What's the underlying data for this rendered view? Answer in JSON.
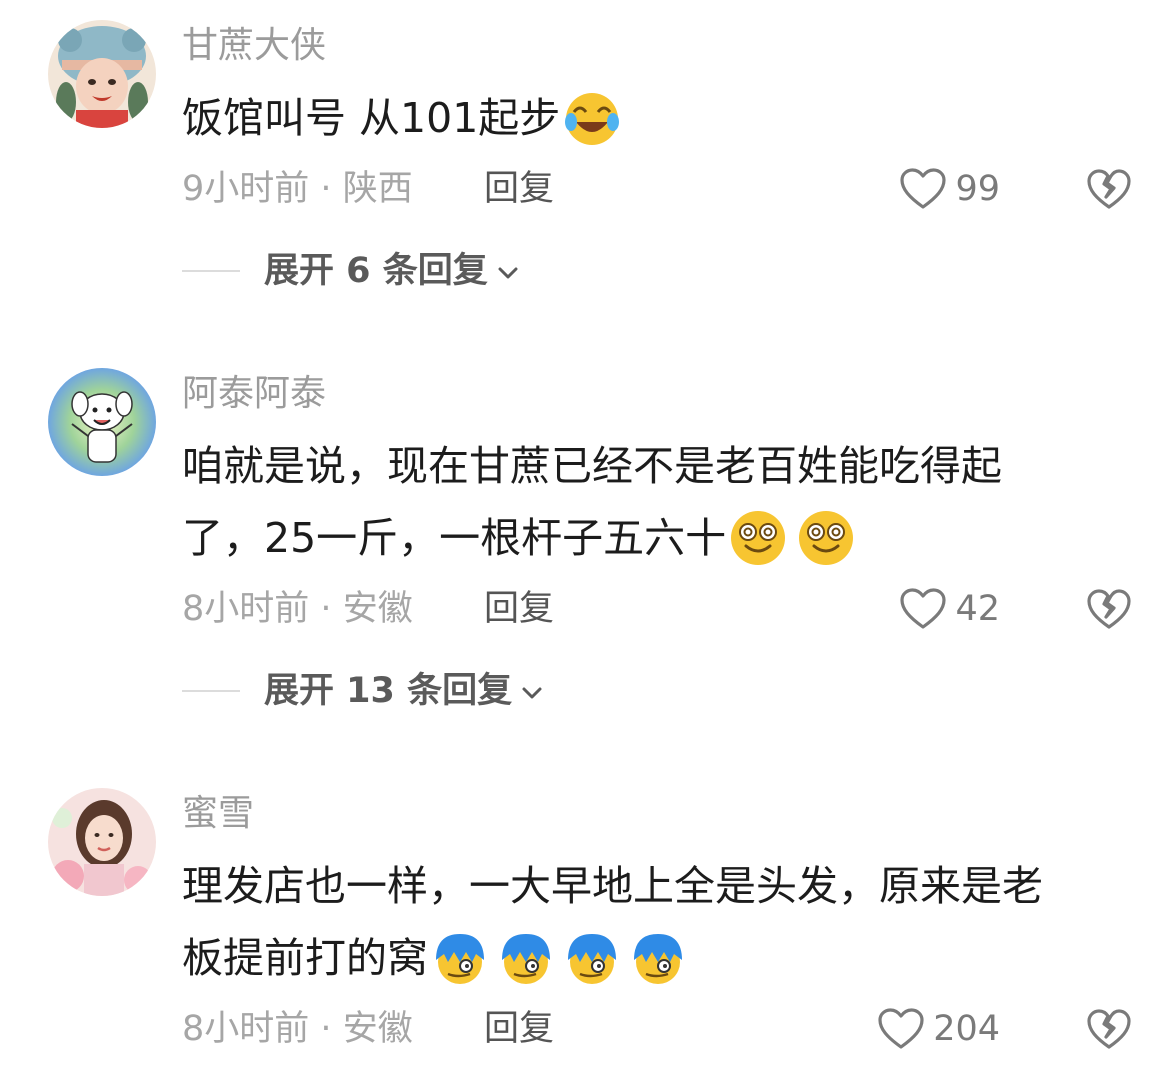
{
  "comments": [
    {
      "username": "甘蔗大侠",
      "avatar": "avatar-girl-bear-hat",
      "text_lines": [
        "饭馆叫号  从101起步"
      ],
      "emojis": [
        "crying-laugh-emoji"
      ],
      "time": "9小时前",
      "separator": "·",
      "location": "陕西",
      "reply_label": "回复",
      "likes": "99",
      "expand_label": "展开 6 条回复"
    },
    {
      "username": "阿泰阿泰",
      "avatar": "avatar-dog-cartoon",
      "text_lines": [
        "咱就是说，现在甘蔗已经不是老百姓能吃得起",
        "了，25一斤，一根杆子五六十"
      ],
      "emojis": [
        "dizzy-smile-emoji",
        "dizzy-smile-emoji"
      ],
      "time": "8小时前",
      "separator": "·",
      "location": "安徽",
      "reply_label": "回复",
      "likes": "42",
      "expand_label": "展开 13 条回复"
    },
    {
      "username": "蜜雪",
      "avatar": "avatar-girl-flowers",
      "text_lines": [
        "理发店也一样，一大早地上全是头发，原来是老",
        "板提前打的窝"
      ],
      "emojis": [
        "blue-hair-emoji",
        "blue-hair-emoji",
        "blue-hair-emoji",
        "blue-hair-emoji"
      ],
      "time": "8小时前",
      "separator": "·",
      "location": "安徽",
      "reply_label": "回复",
      "likes": "204"
    }
  ],
  "colors": {
    "username": "#9b9b9b",
    "content": "#1c1c1c",
    "meta": "#a6a6a6",
    "reply": "#555555",
    "expand": "#5a5a5a",
    "emoji_yellow": "#f7c531",
    "emoji_blue": "#2f8be6"
  }
}
